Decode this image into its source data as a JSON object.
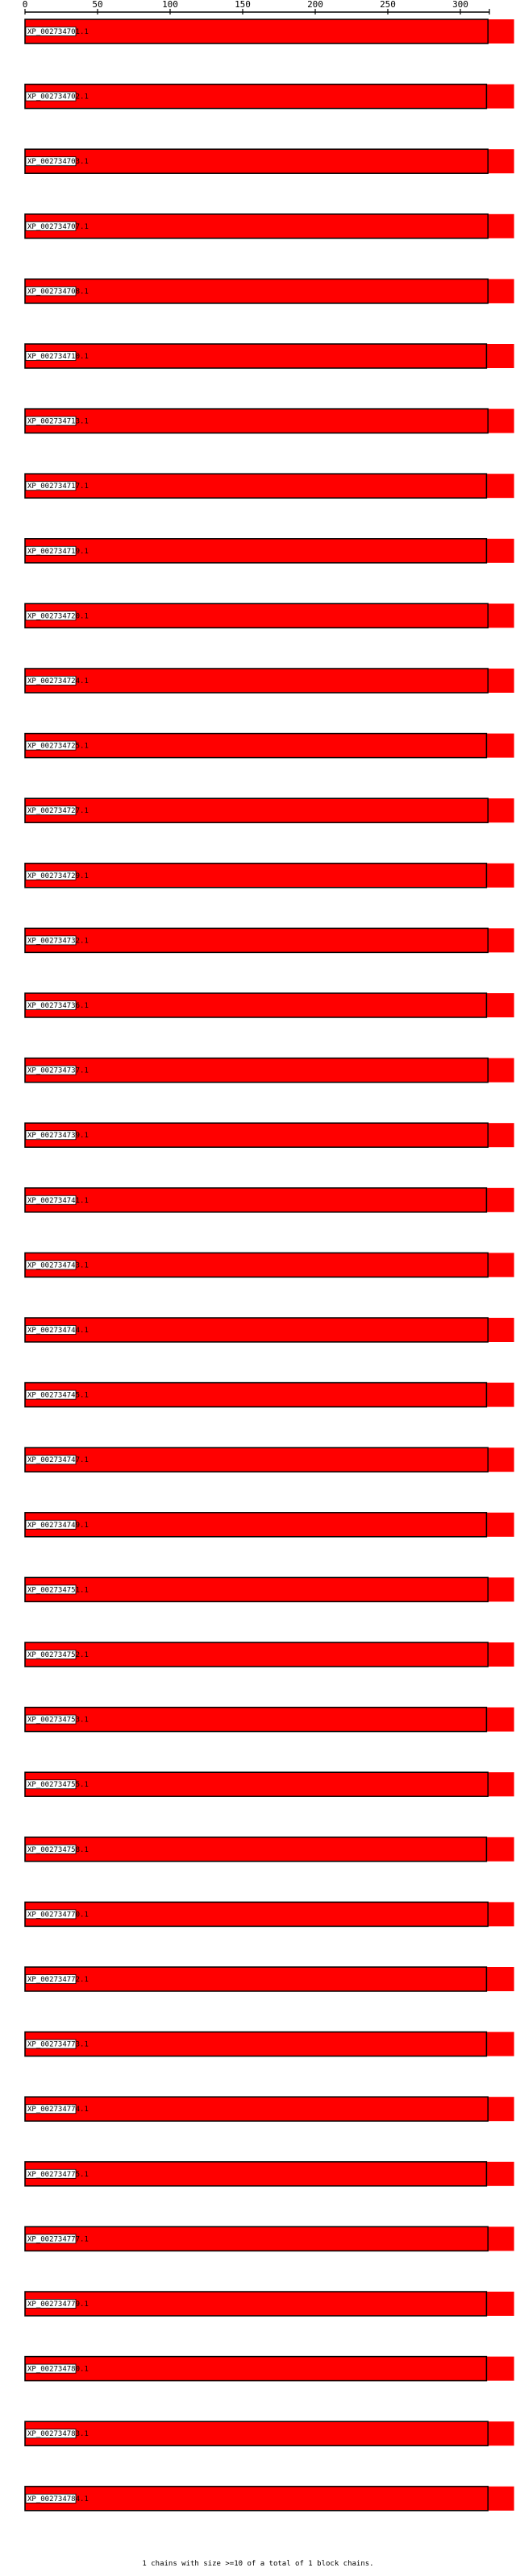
{
  "chart_data": {
    "type": "bar",
    "orientation": "horizontal",
    "xlim": [
      0,
      320
    ],
    "x_ticks": [
      0,
      50,
      100,
      150,
      200,
      250,
      300
    ],
    "categories": [
      "XP_002734701.1",
      "XP_002734702.1",
      "XP_002734703.1",
      "XP_002734707.1",
      "XP_002734708.1",
      "XP_002734710.1",
      "XP_002734713.1",
      "XP_002734717.1",
      "XP_002734719.1",
      "XP_002734720.1",
      "XP_002734724.1",
      "XP_002734725.1",
      "XP_002734727.1",
      "XP_002734729.1",
      "XP_002734732.1",
      "XP_002734736.1",
      "XP_002734737.1",
      "XP_002734739.1",
      "XP_002734741.1",
      "XP_002734743.1",
      "XP_002734744.1",
      "XP_002734745.1",
      "XP_002734747.1",
      "XP_002734749.1",
      "XP_002734751.1",
      "XP_002734752.1",
      "XP_002734753.1",
      "XP_002734755.1",
      "XP_002734758.1",
      "XP_002734770.1",
      "XP_002734772.1",
      "XP_002734773.1",
      "XP_002734774.1",
      "XP_002734775.1",
      "XP_002734777.1",
      "XP_002734779.1",
      "XP_002734780.1",
      "XP_002734783.1",
      "XP_002734784.1"
    ],
    "values": [
      319,
      318,
      319,
      319,
      319,
      318,
      319,
      318,
      318,
      319,
      319,
      318,
      319,
      318,
      319,
      318,
      319,
      319,
      318,
      319,
      319,
      318,
      319,
      318,
      319,
      319,
      318,
      319,
      318,
      319,
      318,
      318,
      319,
      318,
      319,
      318,
      318,
      319,
      319
    ],
    "chain_extent": 337,
    "bar_color": "#ff0000",
    "outline_color": "#000000",
    "summary_text": "1 chains with size >=10 of a total of 1 block chains."
  }
}
